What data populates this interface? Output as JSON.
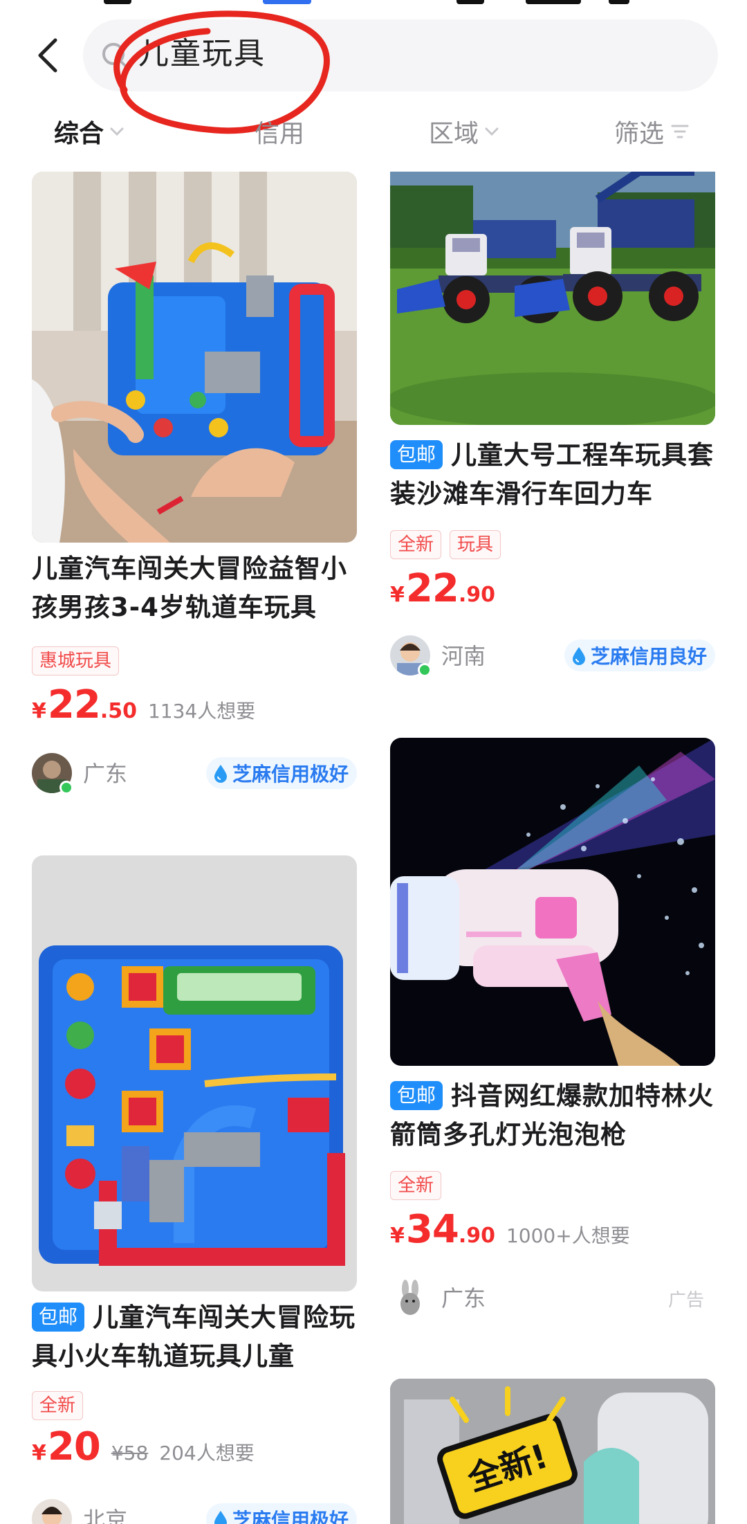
{
  "search": {
    "query": "儿童玩具"
  },
  "filters": [
    {
      "label": "综合"
    },
    {
      "label": "信用"
    },
    {
      "label": "区域"
    },
    {
      "label": "筛选"
    }
  ],
  "products": [
    {
      "title": "儿童汽车闯关大冒险益智小孩男孩3-4岁轨道车玩具",
      "free_shipping": false,
      "tags": [
        "惠城玩具"
      ],
      "price_currency": "¥",
      "price_int": "22",
      "price_dec": ".50",
      "price_old": "",
      "wants": "1134人想要",
      "region": "广东",
      "credit": "芝麻信用极好",
      "ad": "",
      "image_desc": "blue-track-toy"
    },
    {
      "title": "儿童大号工程车玩具套装沙滩车滑行车回力车",
      "free_shipping": true,
      "free_label": "包邮",
      "tags": [
        "全新",
        "玩具"
      ],
      "price_currency": "¥",
      "price_int": "22",
      "price_dec": ".90",
      "price_old": "",
      "wants": "",
      "region": "河南",
      "credit": "芝麻信用良好",
      "ad": "",
      "image_desc": "construction-trucks-on-grass"
    },
    {
      "title": "抖音网红爆款加特林火箭筒多孔灯光泡泡枪",
      "free_shipping": true,
      "free_label": "包邮",
      "tags": [
        "全新"
      ],
      "price_currency": "¥",
      "price_int": "34",
      "price_dec": ".90",
      "price_old": "",
      "wants": "1000+人想要",
      "region": "广东",
      "credit": "",
      "ad": "广告",
      "image_desc": "bubble-gun"
    },
    {
      "title": "儿童汽车闯关大冒险玩具小火车轨道玩具儿童",
      "free_shipping": true,
      "free_label": "包邮",
      "tags": [
        "全新"
      ],
      "price_currency": "¥",
      "price_int": "20",
      "price_dec": "",
      "price_old": "¥58",
      "wants": "204人想要",
      "region": "北京",
      "credit": "芝麻信用极好",
      "ad": "",
      "image_desc": "blue-track-toy-top-view"
    },
    {
      "title": "",
      "free_shipping": false,
      "tags": [],
      "image_desc": "new-badge-toy-partial"
    }
  ],
  "colors": {
    "price_red": "#f42c2c",
    "badge_blue": "#1f8efa",
    "credit_blue": "#2a7bf0",
    "annotation_red": "#e6261f"
  }
}
